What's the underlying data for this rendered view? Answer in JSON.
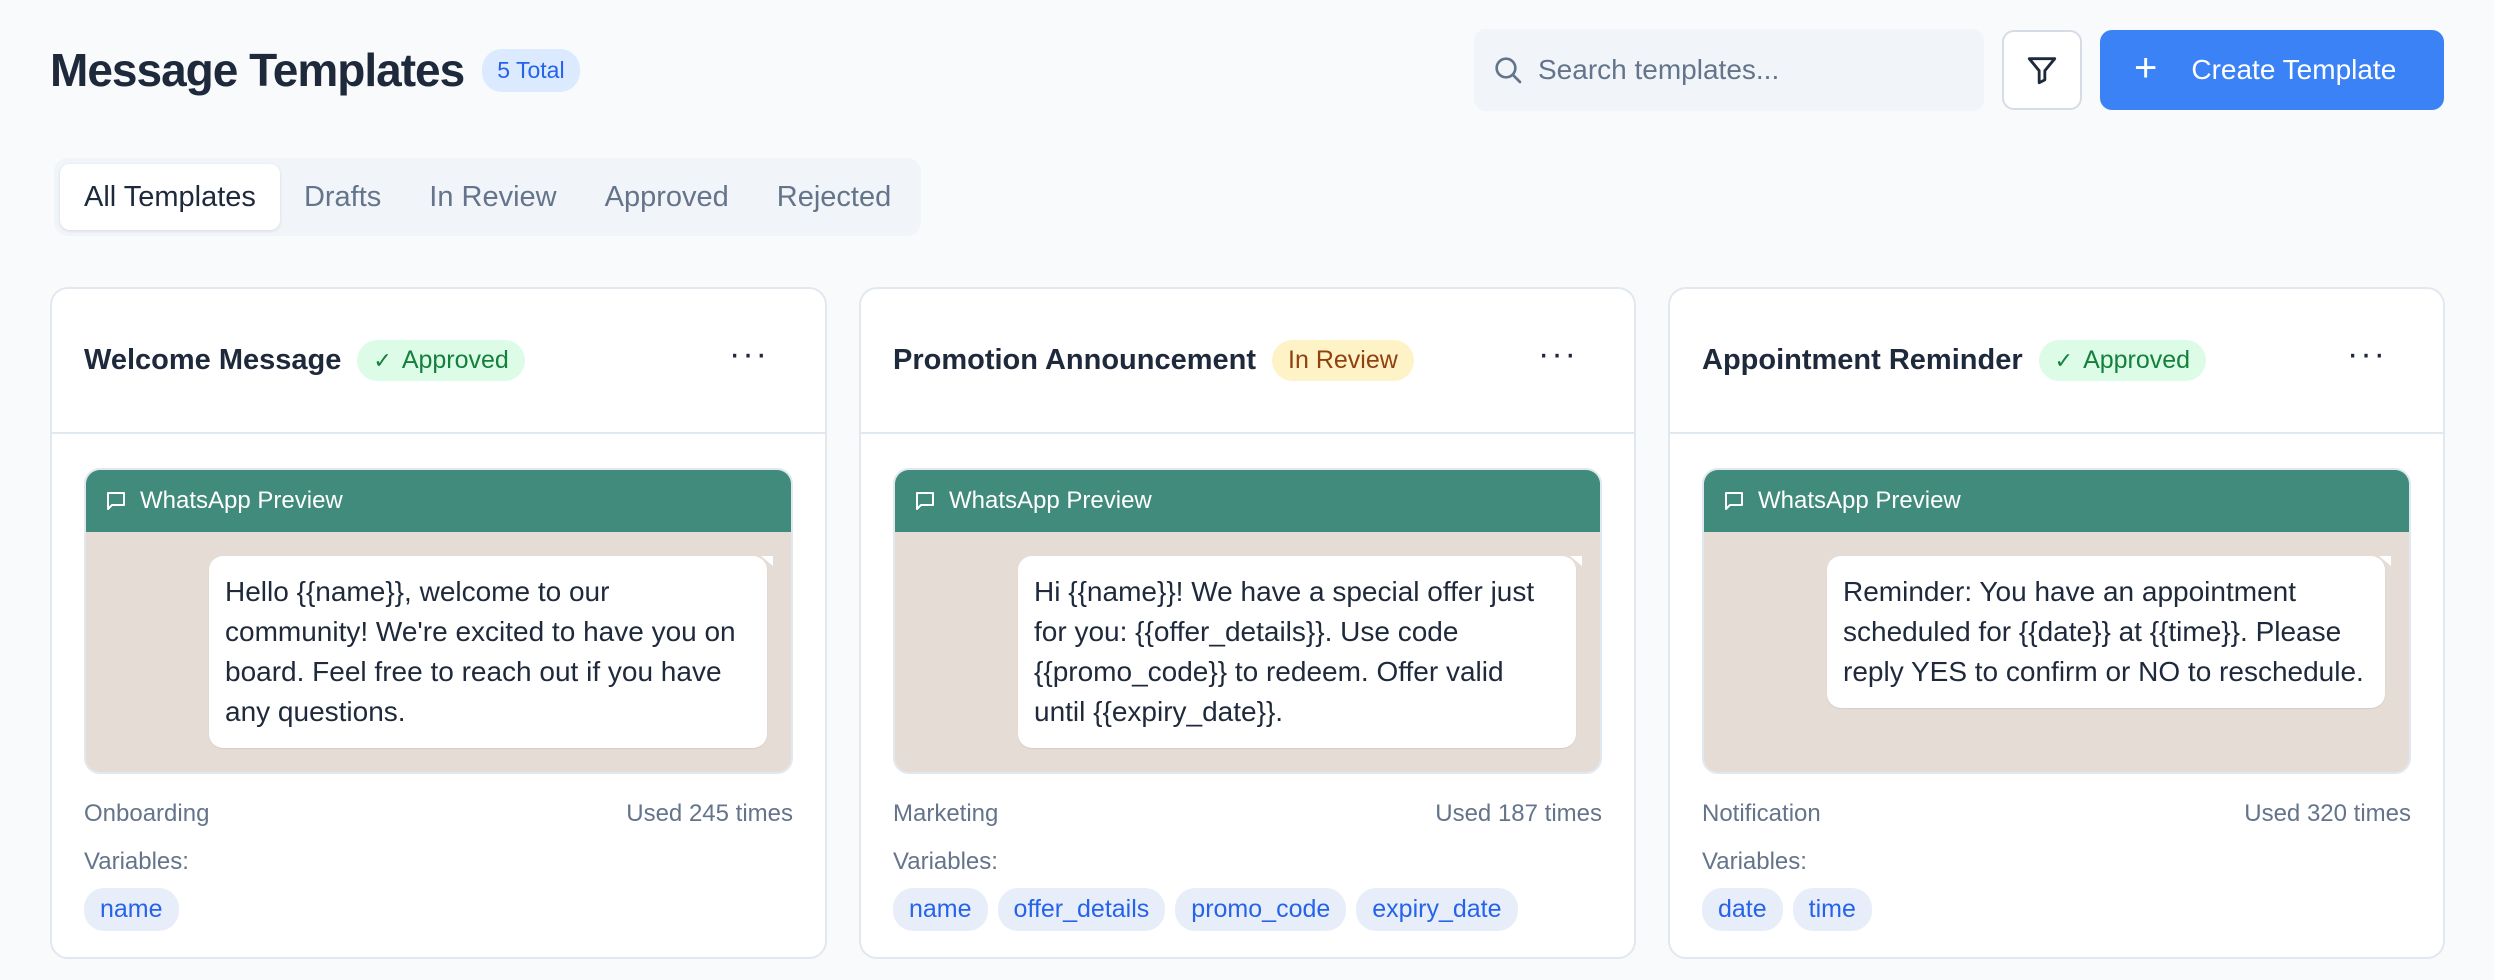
{
  "header": {
    "title": "Message Templates",
    "count_badge": "5 Total",
    "search_placeholder": "Search templates...",
    "create_label": "Create Template"
  },
  "tabs": [
    {
      "label": "All Templates",
      "active": true
    },
    {
      "label": "Drafts"
    },
    {
      "label": "In Review"
    },
    {
      "label": "Approved"
    },
    {
      "label": "Rejected"
    }
  ],
  "cards": [
    {
      "title": "Welcome Message",
      "status": "Approved",
      "preview_label": "WhatsApp Preview",
      "message": "Hello {{name}}, welcome to our community! We're excited to have you on board. Feel free to reach out if you have any questions.",
      "category": "Onboarding",
      "usage": "Used 245 times",
      "variables_label": "Variables:",
      "variables": [
        "name"
      ]
    },
    {
      "title": "Promotion Announcement",
      "status": "In Review",
      "preview_label": "WhatsApp Preview",
      "message": "Hi {{name}}! We have a special offer just for you: {{offer_details}}. Use code {{promo_code}} to redeem. Offer valid until {{expiry_date}}.",
      "category": "Marketing",
      "usage": "Used 187 times",
      "variables_label": "Variables:",
      "variables": [
        "name",
        "offer_details",
        "promo_code",
        "expiry_date"
      ]
    },
    {
      "title": "Appointment Reminder",
      "status": "Approved",
      "preview_label": "WhatsApp Preview",
      "message": "Reminder: You have an appointment scheduled for {{date}} at {{time}}. Please reply YES to confirm or NO to reschedule.",
      "category": "Notification",
      "usage": "Used 320 times",
      "variables_label": "Variables:",
      "variables": [
        "date",
        "time"
      ]
    }
  ],
  "colors": {
    "accent": "#3b82f6",
    "whatsapp_header": "#418b7c",
    "chat_background": "#e5ddd5",
    "approved_bg": "#dcfce7",
    "approved_text": "#15803d",
    "review_bg": "#fef3c7",
    "review_text": "#92400e"
  }
}
